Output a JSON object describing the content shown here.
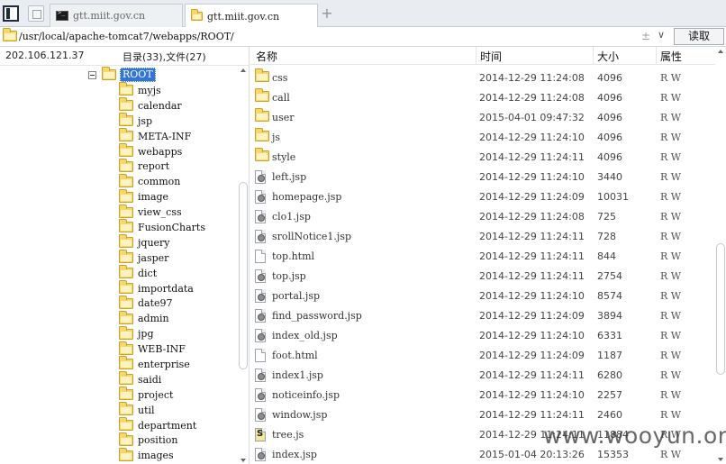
{
  "tabs": [
    {
      "label": "gtt.miit.gov.cn",
      "icon": "terminal-icon",
      "active": false
    },
    {
      "label": "gtt.miit.gov.cn",
      "icon": "folder-icon",
      "active": true
    }
  ],
  "address": {
    "path": "/usr/local/apache-tomcat7/webapps/ROOT/",
    "sort_glyph": "±",
    "dropdown_glyph": "∨",
    "read_button": "读取"
  },
  "left_panel": {
    "ip": "202.106.121.37",
    "counts": "目录(33),文件(27)",
    "root": "ROOT",
    "folders": [
      "myjs",
      "calendar",
      "jsp",
      "META-INF",
      "webapps",
      "report",
      "common",
      "image",
      "view_css",
      "FusionCharts",
      "jquery",
      "jasper",
      "dict",
      "importdata",
      "date97",
      "admin",
      "jpg",
      "WEB-INF",
      "enterprise",
      "saidi",
      "project",
      "util",
      "department",
      "position",
      "images"
    ]
  },
  "columns": {
    "name": "名称",
    "time": "时间",
    "size": "大小",
    "attr": "属性"
  },
  "files": [
    {
      "name": "css",
      "type": "folder",
      "time": "2014-12-29 11:24:08",
      "size": "4096",
      "perm": "R W"
    },
    {
      "name": "call",
      "type": "folder",
      "time": "2014-12-29 11:24:08",
      "size": "4096",
      "perm": "R W"
    },
    {
      "name": "user",
      "type": "folder",
      "time": "2015-04-01 09:47:32",
      "size": "4096",
      "perm": "R W"
    },
    {
      "name": "js",
      "type": "folder",
      "time": "2014-12-29 11:24:10",
      "size": "4096",
      "perm": "R W"
    },
    {
      "name": "style",
      "type": "folder",
      "time": "2014-12-29 11:24:11",
      "size": "4096",
      "perm": "R W"
    },
    {
      "name": "left.jsp",
      "type": "jsp",
      "time": "2014-12-29 11:24:10",
      "size": "3440",
      "perm": "R W"
    },
    {
      "name": "homepage.jsp",
      "type": "jsp",
      "time": "2014-12-29 11:24:09",
      "size": "10031",
      "perm": "R W"
    },
    {
      "name": "clo1.jsp",
      "type": "jsp",
      "time": "2014-12-29 11:24:08",
      "size": "725",
      "perm": "R W"
    },
    {
      "name": "srollNotice1.jsp",
      "type": "jsp",
      "time": "2014-12-29 11:24:11",
      "size": "728",
      "perm": "R W"
    },
    {
      "name": "top.html",
      "type": "html",
      "time": "2014-12-29 11:24:11",
      "size": "844",
      "perm": "R W"
    },
    {
      "name": "top.jsp",
      "type": "jsp",
      "time": "2014-12-29 11:24:11",
      "size": "2754",
      "perm": "R W"
    },
    {
      "name": "portal.jsp",
      "type": "jsp",
      "time": "2014-12-29 11:24:10",
      "size": "8574",
      "perm": "R W"
    },
    {
      "name": "find_password.jsp",
      "type": "jsp",
      "time": "2014-12-29 11:24:09",
      "size": "3894",
      "perm": "R W"
    },
    {
      "name": "index_old.jsp",
      "type": "jsp",
      "time": "2014-12-29 11:24:10",
      "size": "6331",
      "perm": "R W"
    },
    {
      "name": "foot.html",
      "type": "html",
      "time": "2014-12-29 11:24:09",
      "size": "1187",
      "perm": "R W"
    },
    {
      "name": "index1.jsp",
      "type": "jsp",
      "time": "2014-12-29 11:24:11",
      "size": "6280",
      "perm": "R W"
    },
    {
      "name": "noticeinfo.jsp",
      "type": "jsp",
      "time": "2014-12-29 11:24:10",
      "size": "2257",
      "perm": "R W"
    },
    {
      "name": "window.jsp",
      "type": "jsp",
      "time": "2014-12-29 11:24:11",
      "size": "2460",
      "perm": "R W"
    },
    {
      "name": "tree.js",
      "type": "js",
      "time": "2014-12-29 11:24:11",
      "size": "11884",
      "perm": "R W"
    },
    {
      "name": "index.jsp",
      "type": "jsp",
      "time": "2015-01-04 20:13:26",
      "size": "15353",
      "perm": "R W"
    }
  ],
  "watermark": "www.wooyun.org"
}
